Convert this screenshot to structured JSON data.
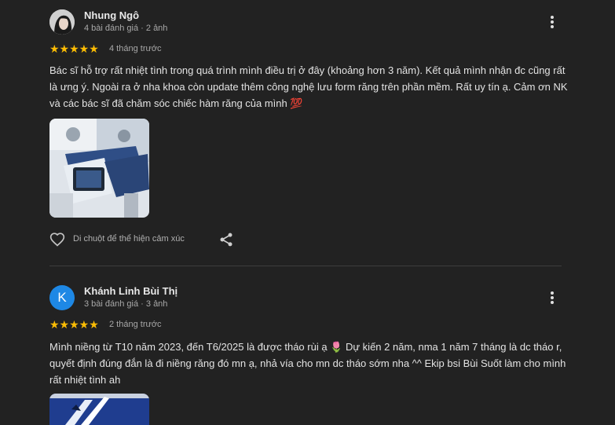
{
  "reviews": [
    {
      "author": "Nhung Ngô",
      "meta": "4 bài đánh giá · 2 ảnh",
      "rating": 5,
      "stars": "★★★★★",
      "time": "4 tháng trước",
      "text": "Bác sĩ hỗ trợ rất nhiệt tình trong quá trình mình điều trị ở đây (khoảng hơn 3 năm). Kết quả mình nhận đc cũng rất là ưng ý. Ngoài ra ở nha khoa còn update thêm công nghệ lưu form răng trên phần mềm. Rất uy tín ạ. Cảm ơn NK và các bác sĩ đã chăm sóc chiếc hàm răng của mình 💯",
      "like_label": "Di chuột để thể hiện cảm xúc"
    },
    {
      "author": "Khánh Linh Bùi Thị",
      "avatar_letter": "K",
      "meta": "3 bài đánh giá · 3 ảnh",
      "rating": 5,
      "stars": "★★★★★",
      "time": "2 tháng trước",
      "text": "Mình niềng từ T10 năm 2023, đến T6/2025 là được tháo rùi ạ 🌷 Dự kiến 2 năm, nma 1 năm 7 tháng là dc tháo r, quyết định đúng đắn là đi niềng răng đó mn ạ, nhả vía cho mn dc tháo sớm nha ^^ Ekip bsi Bùi Suốt làm cho mình rất nhiệt tình ah"
    }
  ],
  "colors": {
    "background": "#222222",
    "star": "#fbbc04",
    "avatar_blue": "#1e88e5"
  }
}
